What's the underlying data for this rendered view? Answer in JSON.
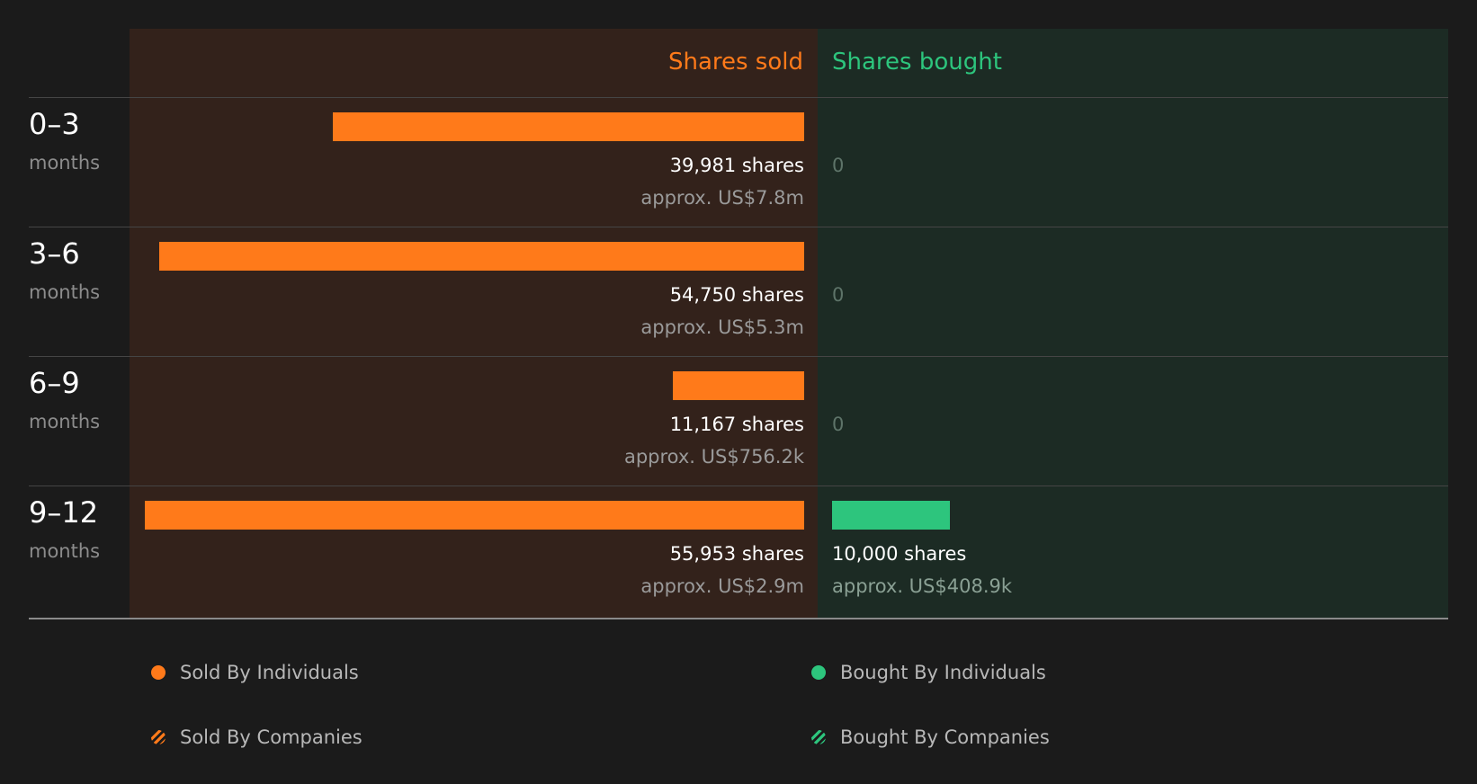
{
  "headers": {
    "sold": "Shares sold",
    "bought": "Shares bought"
  },
  "colors": {
    "sold": "#ff7a1a",
    "bought": "#2dc57d",
    "sold_background": "#33221b",
    "bought_background": "#1c2b24",
    "page_background": "#1b1b1b"
  },
  "periods": [
    {
      "range": "0–3",
      "unit": "months",
      "sold_shares": "39,981 shares",
      "sold_value": "approx. US$7.8m",
      "bought_shares": "0",
      "bought_value": ""
    },
    {
      "range": "3–6",
      "unit": "months",
      "sold_shares": "54,750 shares",
      "sold_value": "approx. US$5.3m",
      "bought_shares": "0",
      "bought_value": ""
    },
    {
      "range": "6–9",
      "unit": "months",
      "sold_shares": "11,167 shares",
      "sold_value": "approx. US$756.2k",
      "bought_shares": "0",
      "bought_value": ""
    },
    {
      "range": "9–12",
      "unit": "months",
      "sold_shares": "55,953 shares",
      "sold_value": "approx. US$2.9m",
      "bought_shares": "10,000 shares",
      "bought_value": "approx. US$408.9k"
    }
  ],
  "legend": [
    {
      "label": "Sold By Individuals",
      "icon": "solid-circle",
      "color": "#ff7a1a"
    },
    {
      "label": "Bought By Individuals",
      "icon": "solid-circle",
      "color": "#2dc57d"
    },
    {
      "label": "Sold By Companies",
      "icon": "striped-circle",
      "color": "#ff7a1a"
    },
    {
      "label": "Bought By Companies",
      "icon": "striped-circle",
      "color": "#2dc57d"
    }
  ],
  "chart_data": {
    "type": "bar",
    "orientation": "horizontal-diverging",
    "categories": [
      "0–3 months",
      "3–6 months",
      "6–9 months",
      "9–12 months"
    ],
    "series": [
      {
        "name": "Shares sold",
        "values": [
          39981,
          54750,
          11167,
          55953
        ],
        "value_usd": [
          7800000,
          5300000,
          756200,
          2900000
        ]
      },
      {
        "name": "Shares bought",
        "values": [
          0,
          0,
          0,
          10000
        ],
        "value_usd": [
          0,
          0,
          0,
          408900
        ]
      }
    ],
    "legend_position": "bottom"
  }
}
